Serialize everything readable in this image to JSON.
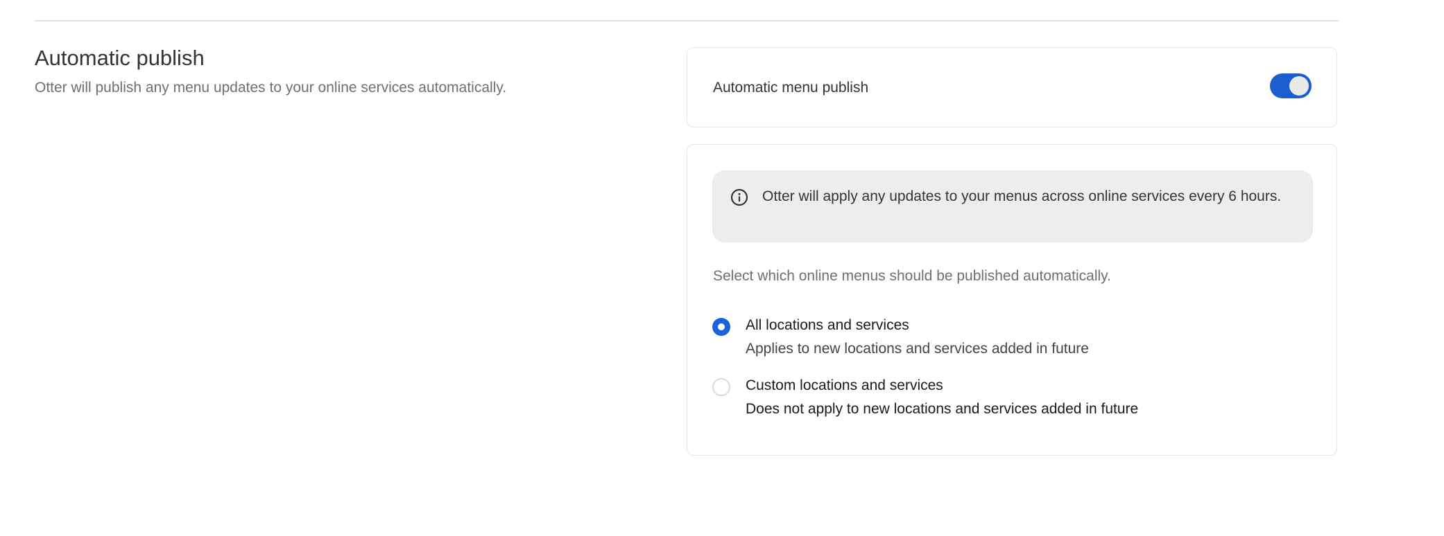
{
  "section": {
    "title": "Automatic publish",
    "description": "Otter will publish any menu updates to your online services automatically."
  },
  "toggle_card": {
    "label": "Automatic menu publish",
    "enabled": true,
    "accent_color": "#1b5ed0"
  },
  "options_card": {
    "info": {
      "icon": "info-circle-icon",
      "text": "Otter will apply any updates to your menus across online services every 6 hours."
    },
    "prompt": "Select which online menus should be published automatically.",
    "options": [
      {
        "title": "All locations and services",
        "subtitle": "Applies to new locations and services added in future",
        "selected": true
      },
      {
        "title": "Custom locations and services",
        "subtitle": "Does not apply to new locations and services added in future",
        "selected": false
      }
    ]
  }
}
